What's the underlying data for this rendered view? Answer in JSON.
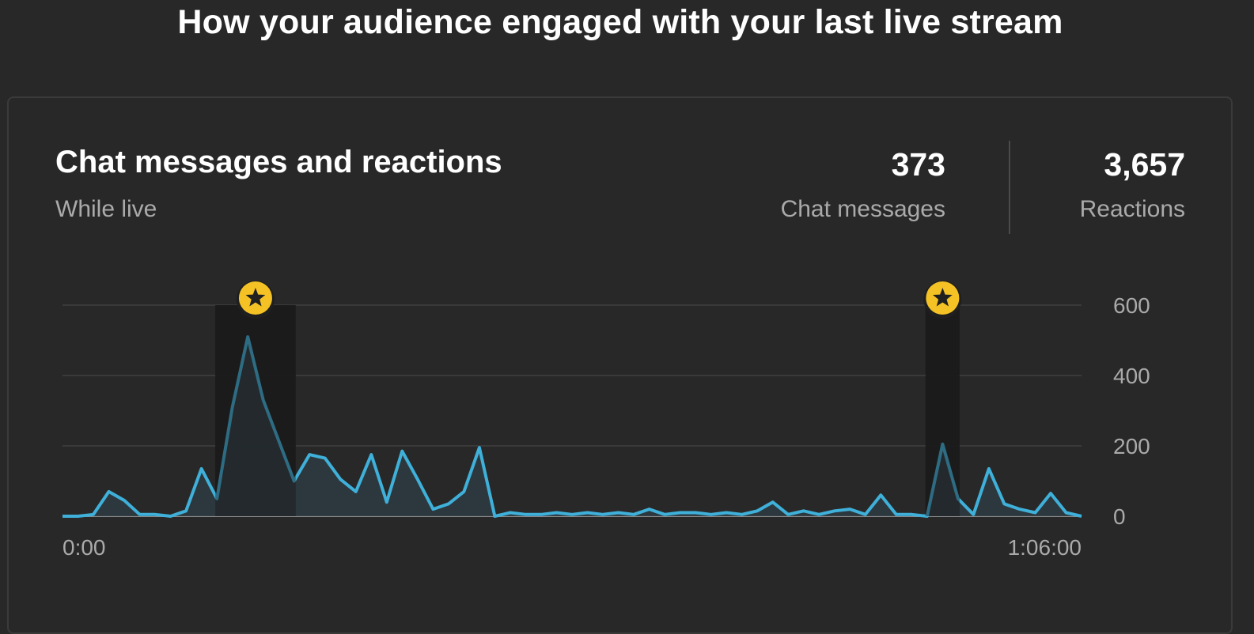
{
  "page_title": "How your audience engaged with your last live stream",
  "card": {
    "title": "Chat messages and reactions",
    "subtitle": "While live",
    "metrics": [
      {
        "value": "373",
        "label": "Chat messages"
      },
      {
        "value": "3,657",
        "label": "Reactions"
      }
    ]
  },
  "colors": {
    "background": "#282828",
    "line": "#3fb0d9",
    "area": "#2c3a40",
    "highlight_band": "#1a1a1a",
    "marker": "#f4c224",
    "grid": "#3a3a3a"
  },
  "chart_data": {
    "type": "area",
    "x_start_label": "0:00",
    "x_end_label": "1:06:00",
    "ylim": [
      0,
      600
    ],
    "y_ticks": [
      0,
      200,
      400,
      600
    ],
    "grid": true,
    "values": [
      0,
      0,
      5,
      70,
      45,
      5,
      5,
      0,
      15,
      135,
      50,
      310,
      510,
      330,
      215,
      100,
      175,
      165,
      105,
      70,
      175,
      40,
      185,
      105,
      20,
      35,
      70,
      195,
      0,
      10,
      5,
      5,
      10,
      5,
      10,
      5,
      10,
      5,
      20,
      5,
      10,
      10,
      5,
      10,
      5,
      15,
      40,
      5,
      15,
      5,
      15,
      20,
      5,
      60,
      5,
      5,
      0,
      205,
      50,
      5,
      135,
      35,
      20,
      10,
      65,
      10,
      0
    ],
    "highlights": [
      {
        "from_index": 10,
        "to_index": 15,
        "icon": "star-icon"
      },
      {
        "from_index": 56,
        "to_index": 58,
        "icon": "star-icon"
      }
    ]
  }
}
